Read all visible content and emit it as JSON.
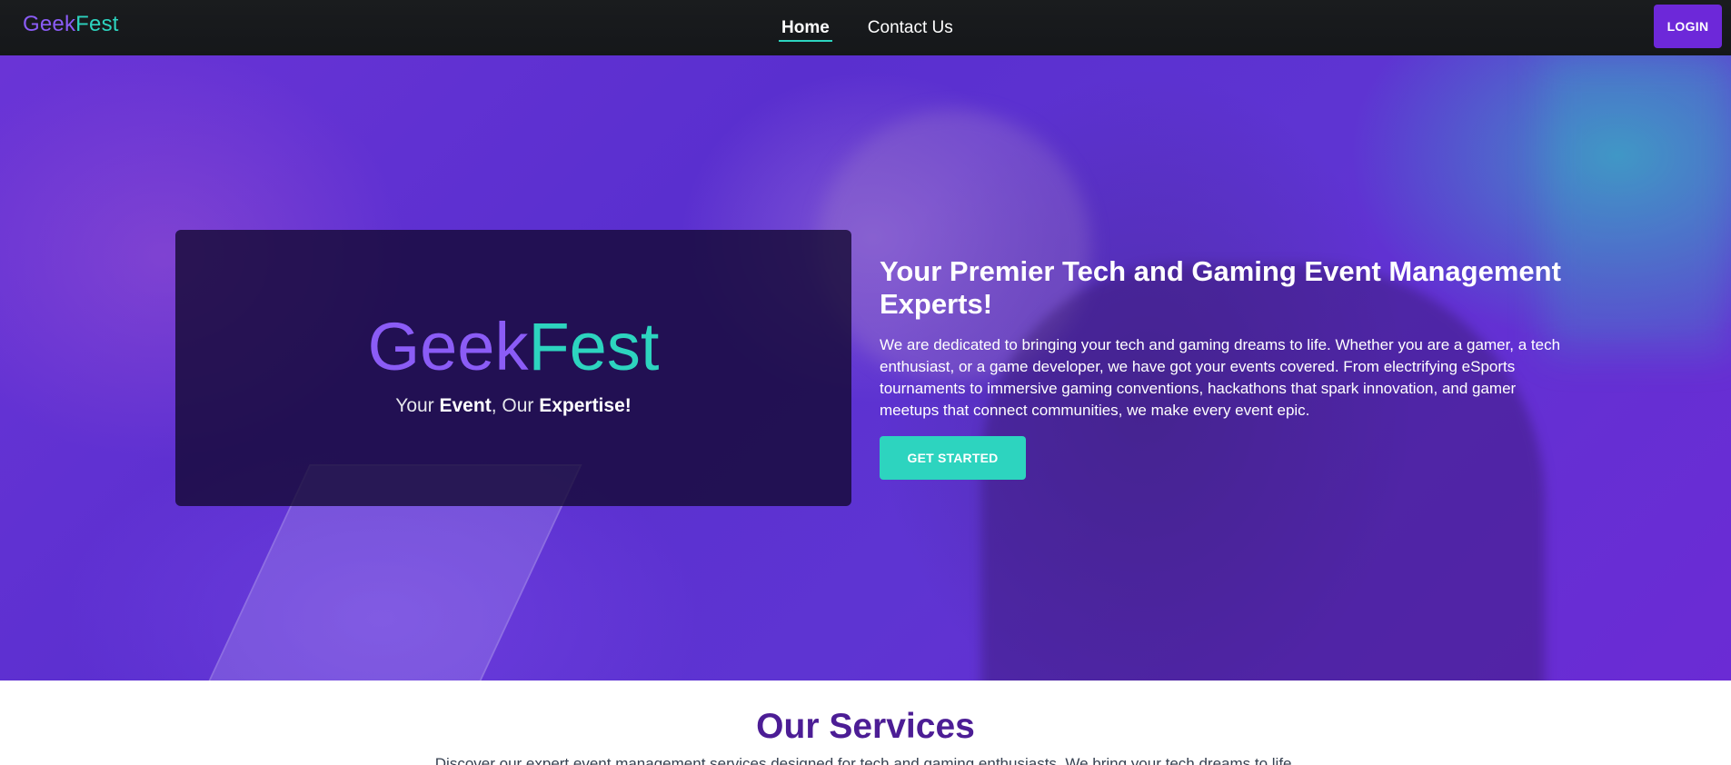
{
  "nav": {
    "brand_part1": "Geek",
    "brand_part2": "Fest",
    "links": [
      {
        "label": "Home",
        "active": true
      },
      {
        "label": "Contact Us",
        "active": false
      }
    ],
    "login_label": "LOGIN"
  },
  "hero": {
    "card": {
      "title_part1": "Geek",
      "title_part2": "Fest",
      "tagline": {
        "w1": "Your ",
        "w2": "Event",
        "w3": ", Our ",
        "w4": "Expertise!"
      }
    },
    "heading": "Your Premier Tech and Gaming Event Management Experts!",
    "text": "We are dedicated to bringing your tech and gaming dreams to life. Whether you are a gamer, a tech enthusiast, or a game developer, we have got your events covered. From electrifying eSports tournaments to immersive gaming conventions, hackathons that spark innovation, and gamer meetups that connect communities, we make every event epic.",
    "cta_label": "GET STARTED"
  },
  "services": {
    "title": "Our Services",
    "text": "Discover our expert event management services designed for tech and gaming enthusiasts. We bring your tech dreams to life."
  },
  "colors": {
    "accent_purple": "#8b5cf6",
    "accent_teal": "#2dd4bf",
    "button_purple": "#6d28d9",
    "navbar_bg": "#15171a",
    "services_title": "#4c1d95"
  }
}
